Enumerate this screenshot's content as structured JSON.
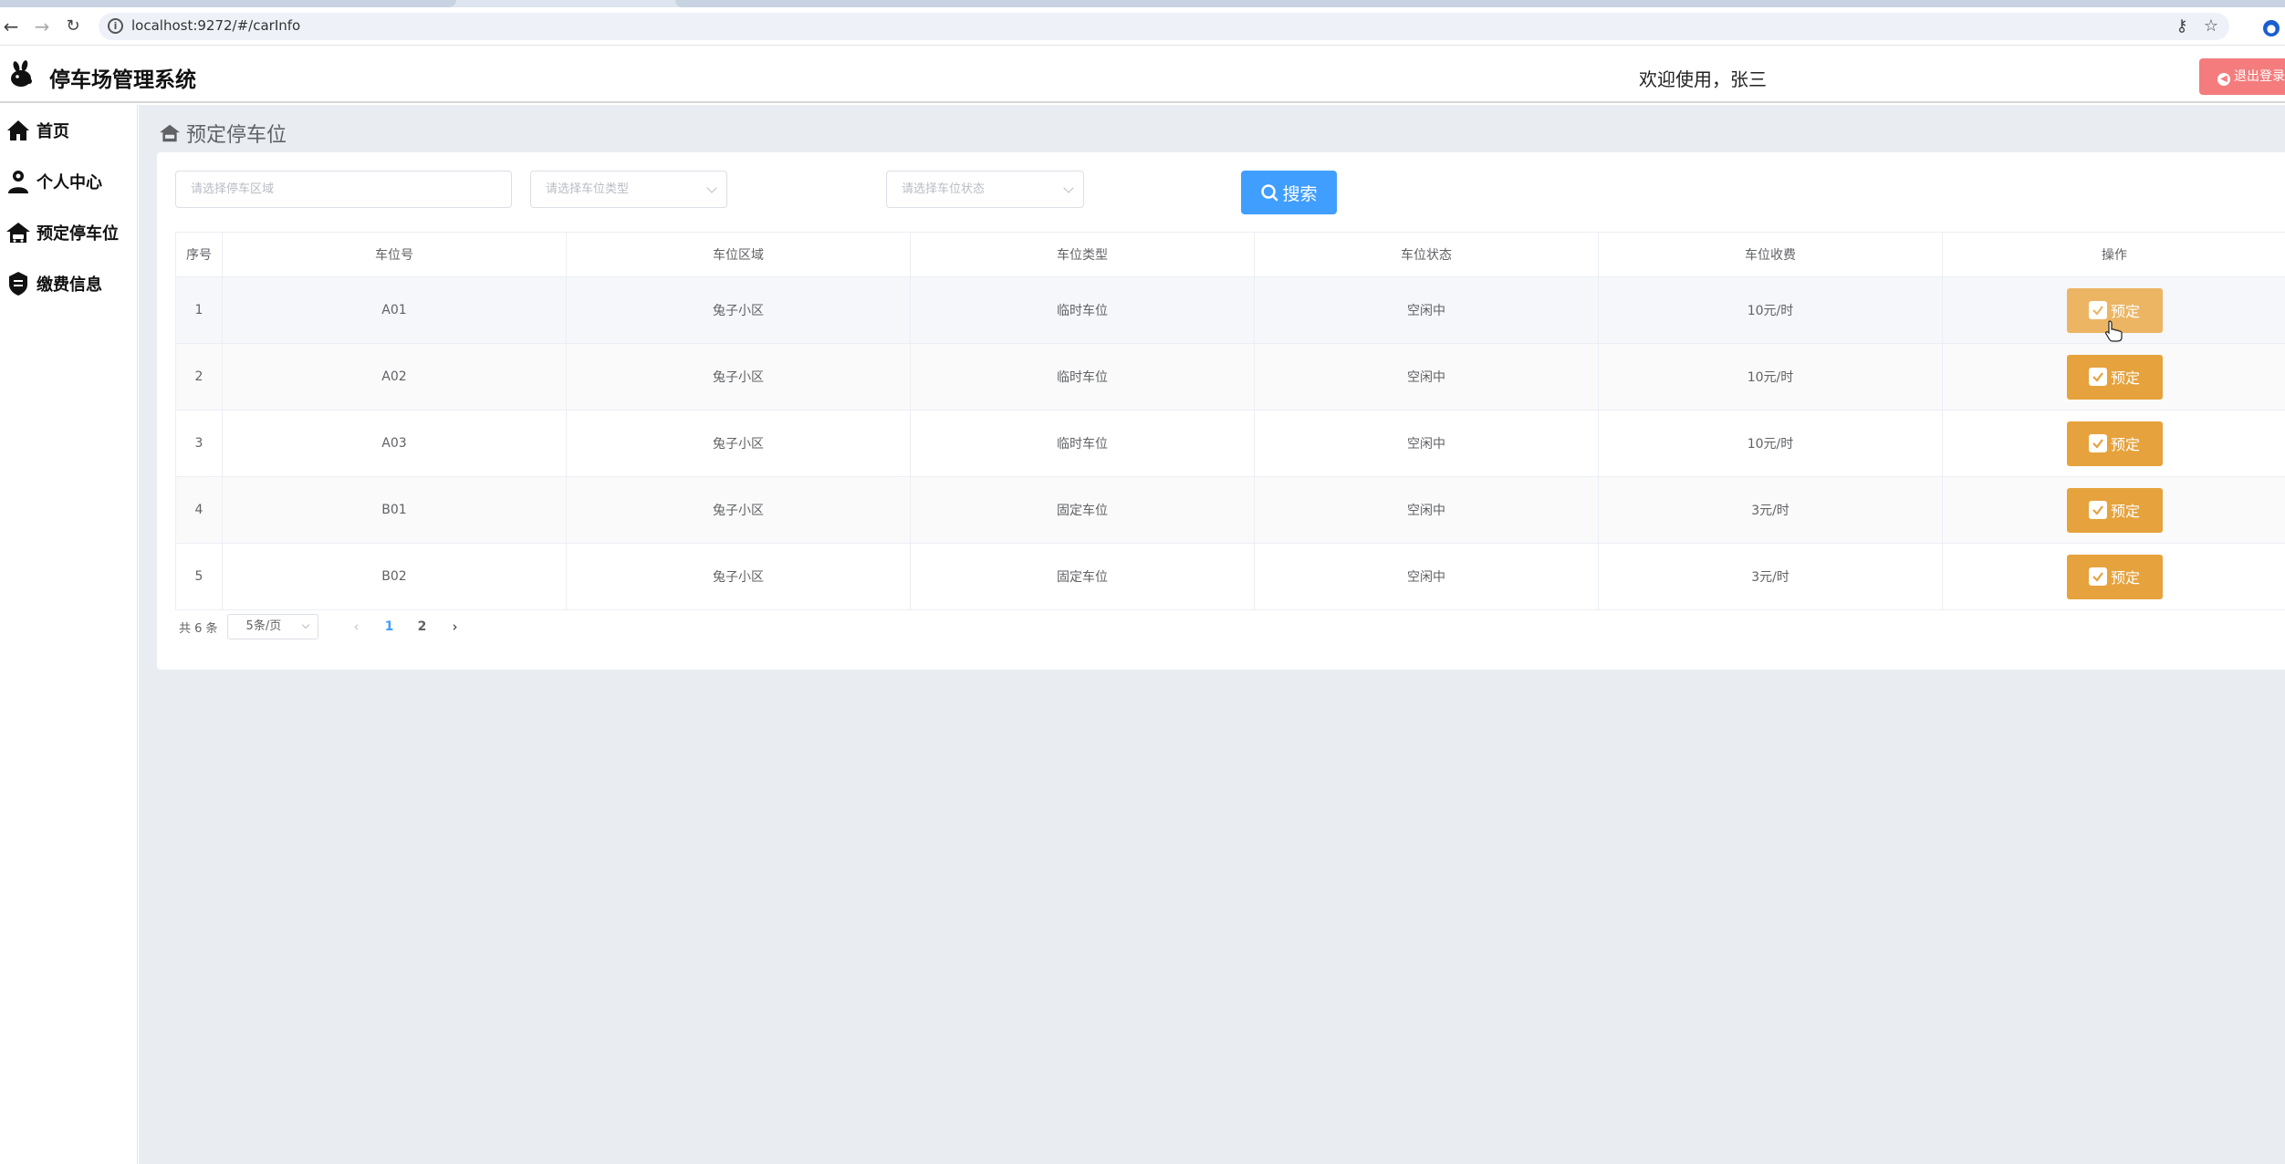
{
  "browser": {
    "url": "localhost:9272/#/carInfo"
  },
  "header": {
    "app_title": "停车场管理系统",
    "welcome": "欢迎使用，张三",
    "logout_label": "退出登录"
  },
  "sidebar": {
    "items": [
      {
        "label": "首页",
        "icon": "home-icon"
      },
      {
        "label": "个人中心",
        "icon": "user-icon"
      },
      {
        "label": "预定停车位",
        "icon": "car-icon"
      },
      {
        "label": "缴费信息",
        "icon": "payment-icon"
      }
    ]
  },
  "page": {
    "title": "预定停车位"
  },
  "filters": {
    "area_placeholder": "请选择停车区域",
    "type_placeholder": "请选择车位类型",
    "status_placeholder": "请选择车位状态",
    "search_label": "搜索"
  },
  "table": {
    "columns": [
      "序号",
      "车位号",
      "车位区域",
      "车位类型",
      "车位状态",
      "车位收费",
      "操作"
    ],
    "rows": [
      {
        "index": "1",
        "number": "A01",
        "area": "兔子小区",
        "type": "临时车位",
        "status": "空闲中",
        "fee": "10元/时",
        "action": "预定"
      },
      {
        "index": "2",
        "number": "A02",
        "area": "兔子小区",
        "type": "临时车位",
        "status": "空闲中",
        "fee": "10元/时",
        "action": "预定"
      },
      {
        "index": "3",
        "number": "A03",
        "area": "兔子小区",
        "type": "临时车位",
        "status": "空闲中",
        "fee": "10元/时",
        "action": "预定"
      },
      {
        "index": "4",
        "number": "B01",
        "area": "兔子小区",
        "type": "固定车位",
        "status": "空闲中",
        "fee": "3元/时",
        "action": "预定"
      },
      {
        "index": "5",
        "number": "B02",
        "area": "兔子小区",
        "type": "固定车位",
        "status": "空闲中",
        "fee": "3元/时",
        "action": "预定"
      }
    ]
  },
  "pagination": {
    "total": "共 6 条",
    "page_size": "5条/页",
    "pages": [
      "1",
      "2"
    ],
    "current": "1"
  },
  "colors": {
    "primary": "#409eff",
    "warning": "#e6a23c",
    "danger": "#f47c7c",
    "background": "#e9edf2"
  }
}
